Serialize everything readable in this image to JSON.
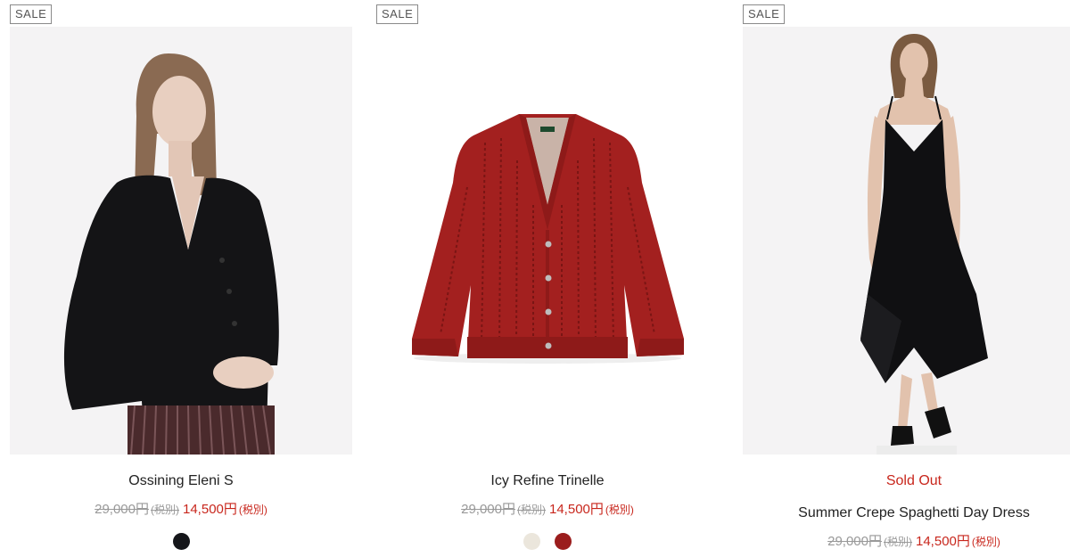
{
  "products": [
    {
      "badge": "SALE",
      "name": "Ossining Eleni S",
      "original_price": "29,000円",
      "original_tax": "(税別)",
      "sale_price": "14,500円",
      "sale_tax": "(税別)",
      "swatches": [
        "#15161a"
      ]
    },
    {
      "badge": "SALE",
      "name": "Icy Refine Trinelle",
      "original_price": "29,000円",
      "original_tax": "(税別)",
      "sale_price": "14,500円",
      "sale_tax": "(税別)",
      "swatches": [
        "#ebe6dc",
        "#9b1d1d"
      ]
    },
    {
      "badge": "SALE",
      "status": "Sold Out",
      "name": "Summer Crepe Spaghetti Day Dress",
      "original_price": "29,000円",
      "original_tax": "(税別)",
      "sale_price": "14,500円",
      "sale_tax": "(税別)"
    }
  ],
  "colors": {
    "sale_red": "#c8261c",
    "strike_gray": "#999999",
    "image_bg": "#f4f3f4"
  }
}
